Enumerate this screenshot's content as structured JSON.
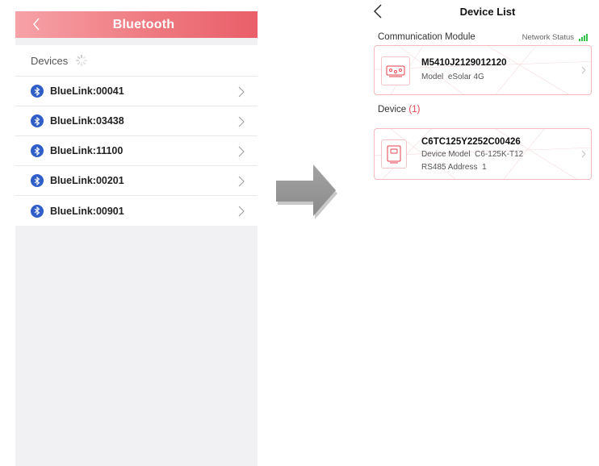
{
  "bluetooth": {
    "title": "Bluetooth",
    "devices_heading": "Devices",
    "devices": [
      {
        "name": "BlueLink:00041"
      },
      {
        "name": "BlueLink:03438"
      },
      {
        "name": "BlueLink:11100"
      },
      {
        "name": "BlueLink:00201"
      },
      {
        "name": "BlueLink:00901"
      }
    ]
  },
  "device_list": {
    "title": "Device List",
    "comm_module_heading": "Communication Module",
    "network_status_label": "Network Status",
    "module_card": {
      "serial": "M5410J2129012120",
      "model_label": "Model",
      "model_value": "eSolar 4G"
    },
    "device_heading": "Device",
    "device_count": "(1)",
    "device_card": {
      "serial": "C6TC125Y2252C00426",
      "model_label": "Device Model",
      "model_value": "C6-125K-T12",
      "rs485_label": "RS485 Address",
      "rs485_value": "1"
    }
  },
  "colors": {
    "accent_red": "#e95f69",
    "bluetooth_blue": "#2f5ec9",
    "signal_green": "#33c24a"
  }
}
